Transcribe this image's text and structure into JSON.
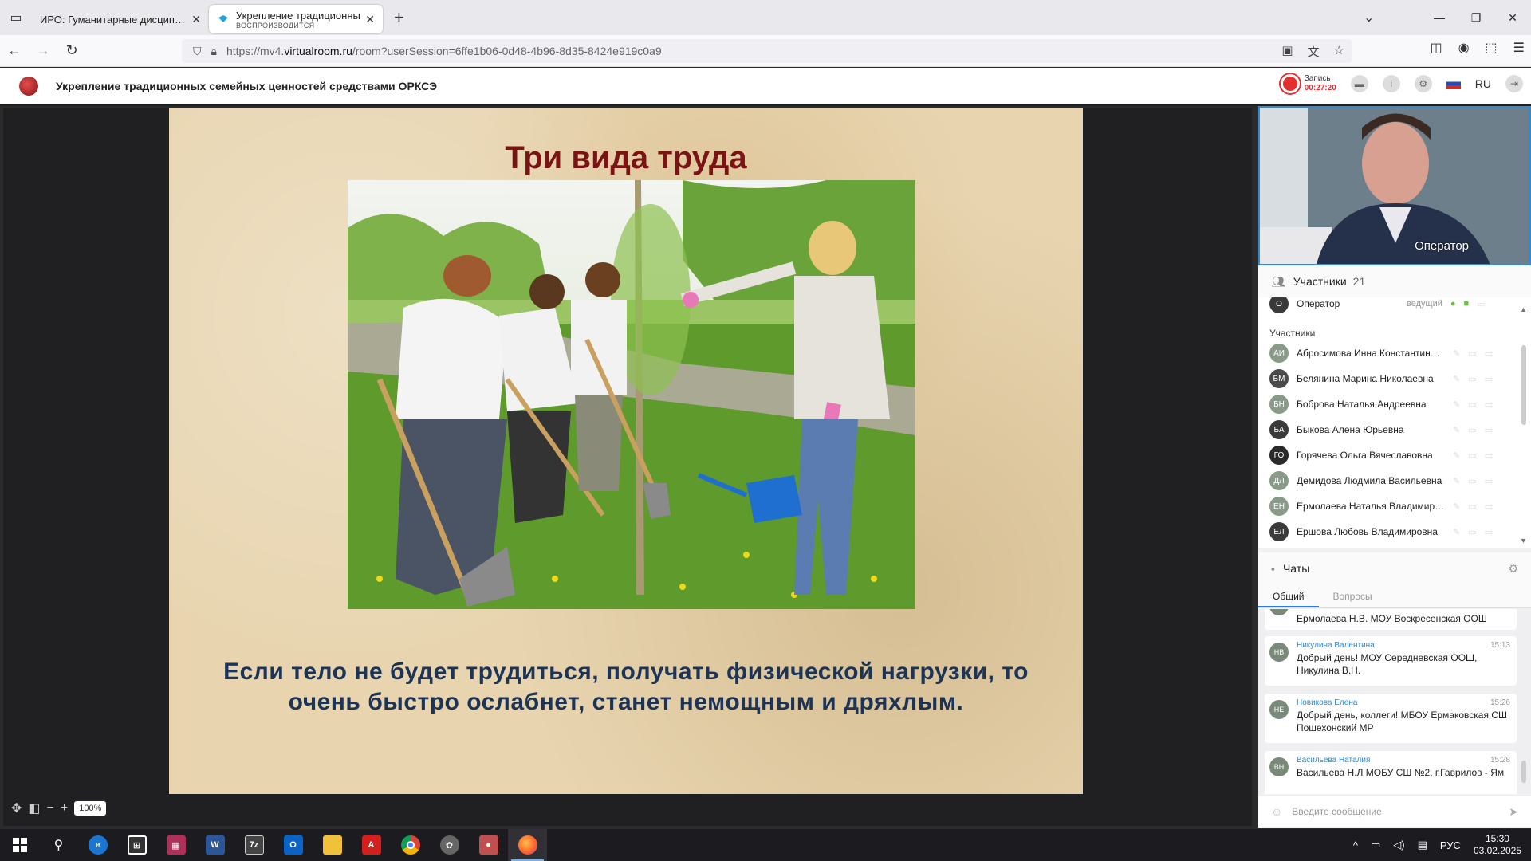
{
  "browser": {
    "tabs": [
      {
        "title": "ИРО: Гуманитарные дисциплины",
        "active": false
      },
      {
        "title": "Укрепление традиционных семейных",
        "subtitle": "ВОСПРОИЗВОДИТСЯ",
        "active": true
      }
    ],
    "url_prefix": "https://mv4.",
    "url_host": "virtualroom.ru",
    "url_rest": "/room?userSession=6ffe1b06-0d48-4b96-8d35-8424e919c0a9"
  },
  "header": {
    "title": "Укрепление традиционных семейных ценностей средствами ОРКСЭ",
    "record_label": "Запись",
    "record_time": "00:27:20",
    "lang": "RU"
  },
  "slide": {
    "title": "Три вида труда",
    "text": "Если тело не будет трудиться, получать физической нагрузки, то очень быстро ослабнет, станет немощным и дряхлым."
  },
  "zoom": {
    "value": "100%"
  },
  "camera": {
    "label": "Оператор"
  },
  "participants": {
    "header": "Участники",
    "count": "21",
    "host": {
      "initial": "О",
      "name": "Оператор",
      "role": "ведущий"
    },
    "subheader": "Участники",
    "list": [
      {
        "initials": "АИ",
        "name": "Абросимова Инна Константиновна",
        "color": "#8a9a8a"
      },
      {
        "initials": "БМ",
        "name": "Белянина Марина Николаевна",
        "color": "#4a4a4a"
      },
      {
        "initials": "БН",
        "name": "Боброва Наталья Андреевна",
        "color": "#8a9a8a"
      },
      {
        "initials": "БА",
        "name": "Быкова Алена Юрьевна",
        "color": "#3a3a3a"
      },
      {
        "initials": "ГО",
        "name": "Горячева Ольга Вячеславовна",
        "color": "#2a2a2a"
      },
      {
        "initials": "ДЛ",
        "name": "Демидова Людмила Васильевна",
        "color": "#8a9a8a"
      },
      {
        "initials": "ЕН",
        "name": "Ермолаева Наталья Владимировна",
        "color": "#8a9a8a"
      },
      {
        "initials": "ЕЛ",
        "name": "Ершова Любовь Владимировна",
        "color": "#3a3a3a"
      }
    ]
  },
  "chat": {
    "header": "Чаты",
    "tabs": [
      "Общий",
      "Вопросы"
    ],
    "messages": [
      {
        "initials": "",
        "name": "",
        "time": "",
        "text": "Ермолаева Н.В. МОУ Воскресенская ООШ"
      },
      {
        "initials": "НВ",
        "name": "Никулина Валентина",
        "time": "15:13",
        "text": "Добрый день! МОУ Середневская ООШ, Никулина В.Н."
      },
      {
        "initials": "НЕ",
        "name": "Новикова Елена",
        "time": "15:26",
        "text": "Добрый день, коллеги! МБОУ Ермаковская СШ Пошехонский МР"
      },
      {
        "initials": "ВН",
        "name": "Васильева Наталия",
        "time": "15:28",
        "text": "Васильева Н.Л МОБУ СШ №2, г.Гаврилов - Ям"
      }
    ],
    "input_placeholder": "Введите сообщение"
  },
  "taskbar": {
    "lang": "РУС",
    "time": "15:30",
    "date": "03.02.2025"
  }
}
